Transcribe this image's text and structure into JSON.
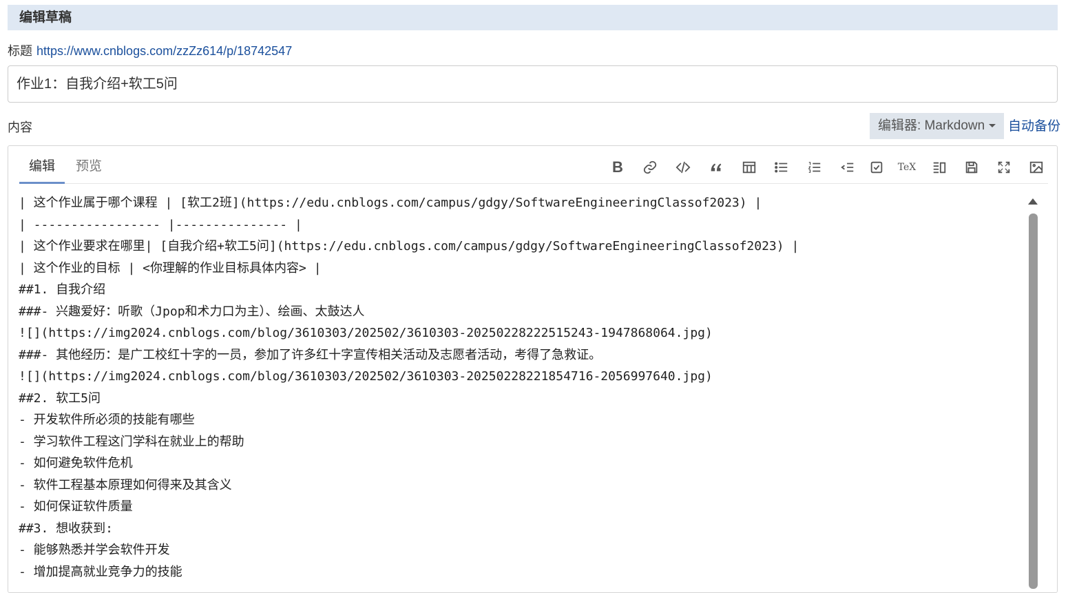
{
  "header": {
    "title": "编辑草稿"
  },
  "title_field": {
    "label": "标题",
    "link": "https://www.cnblogs.com/zzZz614/p/18742547",
    "value": "作业1：自我介绍+软工5问"
  },
  "content": {
    "label": "内容",
    "editor_select": "编辑器: Markdown",
    "autobackup": "自动备份"
  },
  "tabs": [
    {
      "label": "编辑",
      "active": true
    },
    {
      "label": "预览",
      "active": false
    }
  ],
  "toolbar": {
    "bold": "B",
    "tex": "TeX",
    "icons": [
      "bold-icon",
      "link-icon",
      "code-icon",
      "quote-icon",
      "table-icon",
      "unordered-list-icon",
      "ordered-list-icon",
      "outdent-icon",
      "checkbox-icon",
      "tex-icon",
      "preview-split-icon",
      "save-icon",
      "fullscreen-icon",
      "image-icon"
    ]
  },
  "editor_lines": [
    "| 这个作业属于哪个课程 | [软工2班](https://edu.cnblogs.com/campus/gdgy/SoftwareEngineeringClassof2023) |",
    "| ----------------- |--------------- |",
    "| 这个作业要求在哪里| [自我介绍+软工5问](https://edu.cnblogs.com/campus/gdgy/SoftwareEngineeringClassof2023) |",
    "| 这个作业的目标 | <你理解的作业目标具体内容> |",
    "##1. 自我介绍",
    "###- 兴趣爱好：听歌（Jpop和术力口为主）、绘画、太鼓达人",
    "![](https://img2024.cnblogs.com/blog/3610303/202502/3610303-20250228222515243-1947868064.jpg)",
    "###- 其他经历：是广工校红十字的一员，参加了许多红十字宣传相关活动及志愿者活动，考得了急救证。",
    "![](https://img2024.cnblogs.com/blog/3610303/202502/3610303-20250228221854716-2056997640.jpg)",
    "##2. 软工5问",
    "- 开发软件所必须的技能有哪些",
    "- 学习软件工程这门学科在就业上的帮助",
    "- 如何避免软件危机",
    "- 软件工程基本原理如何得来及其含义",
    "- 如何保证软件质量",
    "##3. 想收获到:",
    "- 能够熟悉并学会软件开发",
    "- 增加提高就业竞争力的技能"
  ],
  "colors": {
    "header_bg": "#dfe8f3",
    "link": "#1a4f9c",
    "tab_underline": "#6b8fc9",
    "select_bg": "#dfe5ec"
  }
}
